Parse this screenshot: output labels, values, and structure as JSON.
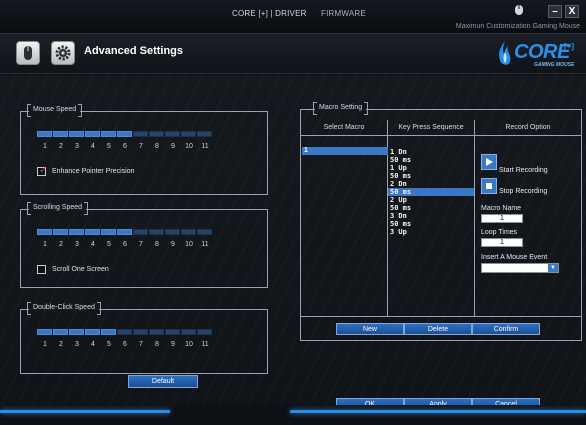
{
  "topbar": {
    "nav_driver": "CORE [+] | DRIVER",
    "nav_firmware": "FIRMWARE",
    "subtitle": "Maximun Customization Gaming Mouse",
    "minimize_label": "–",
    "close_label": "X"
  },
  "header": {
    "title": "Advanced Settings",
    "logo_text": "CORE",
    "logo_plus": "[+]",
    "logo_sub": "GAMING MOUSE"
  },
  "mouse_speed": {
    "title": "Mouse Speed",
    "level": 6,
    "ticks": [
      "1",
      "2",
      "3",
      "4",
      "5",
      "6",
      "7",
      "8",
      "9",
      "10",
      "11"
    ],
    "checkbox_label": "Enhance Pointer Precision",
    "checked": true
  },
  "scrolling_speed": {
    "title": "Scrolling Speed",
    "level": 6,
    "ticks": [
      "1",
      "2",
      "3",
      "4",
      "5",
      "6",
      "7",
      "8",
      "9",
      "10",
      "11"
    ],
    "checkbox_label": "Scroll One Screen",
    "checked": false
  },
  "double_click_speed": {
    "title": "Double-Click Speed",
    "level": 5,
    "ticks": [
      "1",
      "2",
      "3",
      "4",
      "5",
      "6",
      "7",
      "8",
      "9",
      "10",
      "11"
    ]
  },
  "default_label": "Default",
  "macro": {
    "title": "Macro Setting",
    "col_select": "Select Macro",
    "col_sequence": "Key Press Sequence",
    "col_record": "Record Option",
    "selected_macro": "1",
    "sequence": [
      "1  Dn",
      "50 ms",
      "1  Up",
      "50 ms",
      "2  Dn",
      "50 ms",
      "2  Up",
      "50 ms",
      "3  Dn",
      "50 ms",
      "3  Up"
    ],
    "selected_index": 5,
    "start_recording": "Start Recording",
    "stop_recording": "Stop Recording",
    "macro_name_label": "Macro Name",
    "macro_name_value": "1",
    "loop_times_label": "Loop Times",
    "loop_times_value": "1",
    "insert_event_label": "Insert A Mouse Event",
    "new_label": "New",
    "delete_label": "Delete",
    "confirm_label": "Confirm"
  },
  "footer": {
    "ok_label": "OK",
    "apply_label": "Apply",
    "cancel_label": "Cancel"
  },
  "colors": {
    "accent": "#3a78c6",
    "segment_off": "#264466",
    "check_mark": "#e23a3a"
  }
}
